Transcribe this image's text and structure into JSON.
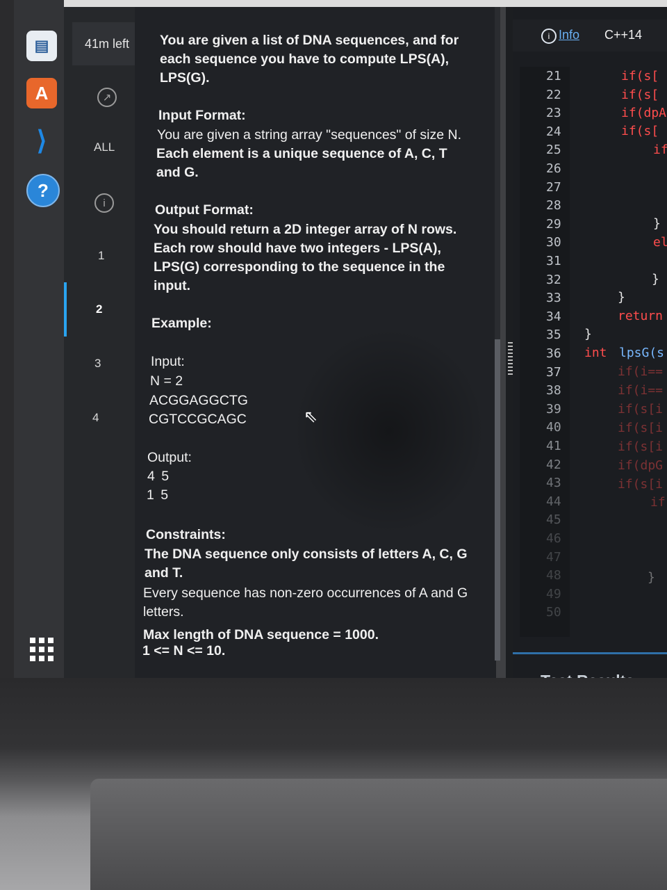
{
  "browser": {
    "url": "hackerrank.com/test/.../questions/..."
  },
  "dock": {
    "apps": [
      "writer-icon",
      "app-store-icon",
      "vscode-icon",
      "help-icon",
      "show-apps-icon"
    ]
  },
  "timer": {
    "label": "41m left"
  },
  "qnav": {
    "all_label": "ALL",
    "items": [
      "1",
      "2",
      "3",
      "4"
    ],
    "active": "2"
  },
  "problem": {
    "intro": "You are given a list of DNA sequences, and for each sequence you have to compute LPS(A), LPS(G).",
    "input_format_title": "Input Format:",
    "input_format_l1": "You are given a string array \"sequences\" of size N.",
    "input_format_l2": "Each element is a unique sequence of A, C, T and G.",
    "output_format_title": "Output Format:",
    "output_format_text": "You should return a 2D integer array of N rows. Each row should have two integers - LPS(A), LPS(G) corresponding to the sequence in the input.",
    "example_title": "Example:",
    "input_label": "Input:",
    "input_n": "N = 2",
    "input_seq1": "ACGGAGGCTG",
    "input_seq2": "CGTCCGCAGC",
    "output_label": "Output:",
    "output_row1": "4 5",
    "output_row2": "1 5",
    "constraints_title": "Constraints:",
    "constraints_l1": "The DNA sequence only consists of letters A, C, G and T.",
    "constraints_l2": "Every sequence has non-zero occurrences of A and G letters.",
    "constraints_l3": "Max length of DNA sequence = 1000.",
    "constraints_l4": "1 <= N <= 10."
  },
  "editor": {
    "info_label": "Info",
    "language": "C++14",
    "line_numbers": [
      "21",
      "22",
      "23",
      "24",
      "25",
      "26",
      "27",
      "28",
      "29",
      "30",
      "31",
      "32",
      "33",
      "34",
      "35",
      "36",
      "37",
      "38",
      "39",
      "40",
      "41",
      "42",
      "43",
      "44",
      "45",
      "46",
      "47",
      "48",
      "49",
      "50"
    ],
    "code_fragments": {
      "l21": "if(s[",
      "l22": "if(s[",
      "l23": "if(dpA",
      "l24": "if(s[",
      "l25": "if",
      "l29": "}",
      "l30": "el",
      "l32": "}",
      "l33": "}",
      "l34": "return",
      "l35": "}",
      "l36_kw": "int",
      "l36_fn": "lpsG(s",
      "l37": "if(i==",
      "l38": "if(i==",
      "l39": "if(s[i",
      "l40": "if(s[i",
      "l41": "if(s[i",
      "l42": "if(dpG",
      "l43": "if(s[i",
      "l44": "if",
      "l48": "}"
    },
    "test_results_label": "Test Results"
  }
}
